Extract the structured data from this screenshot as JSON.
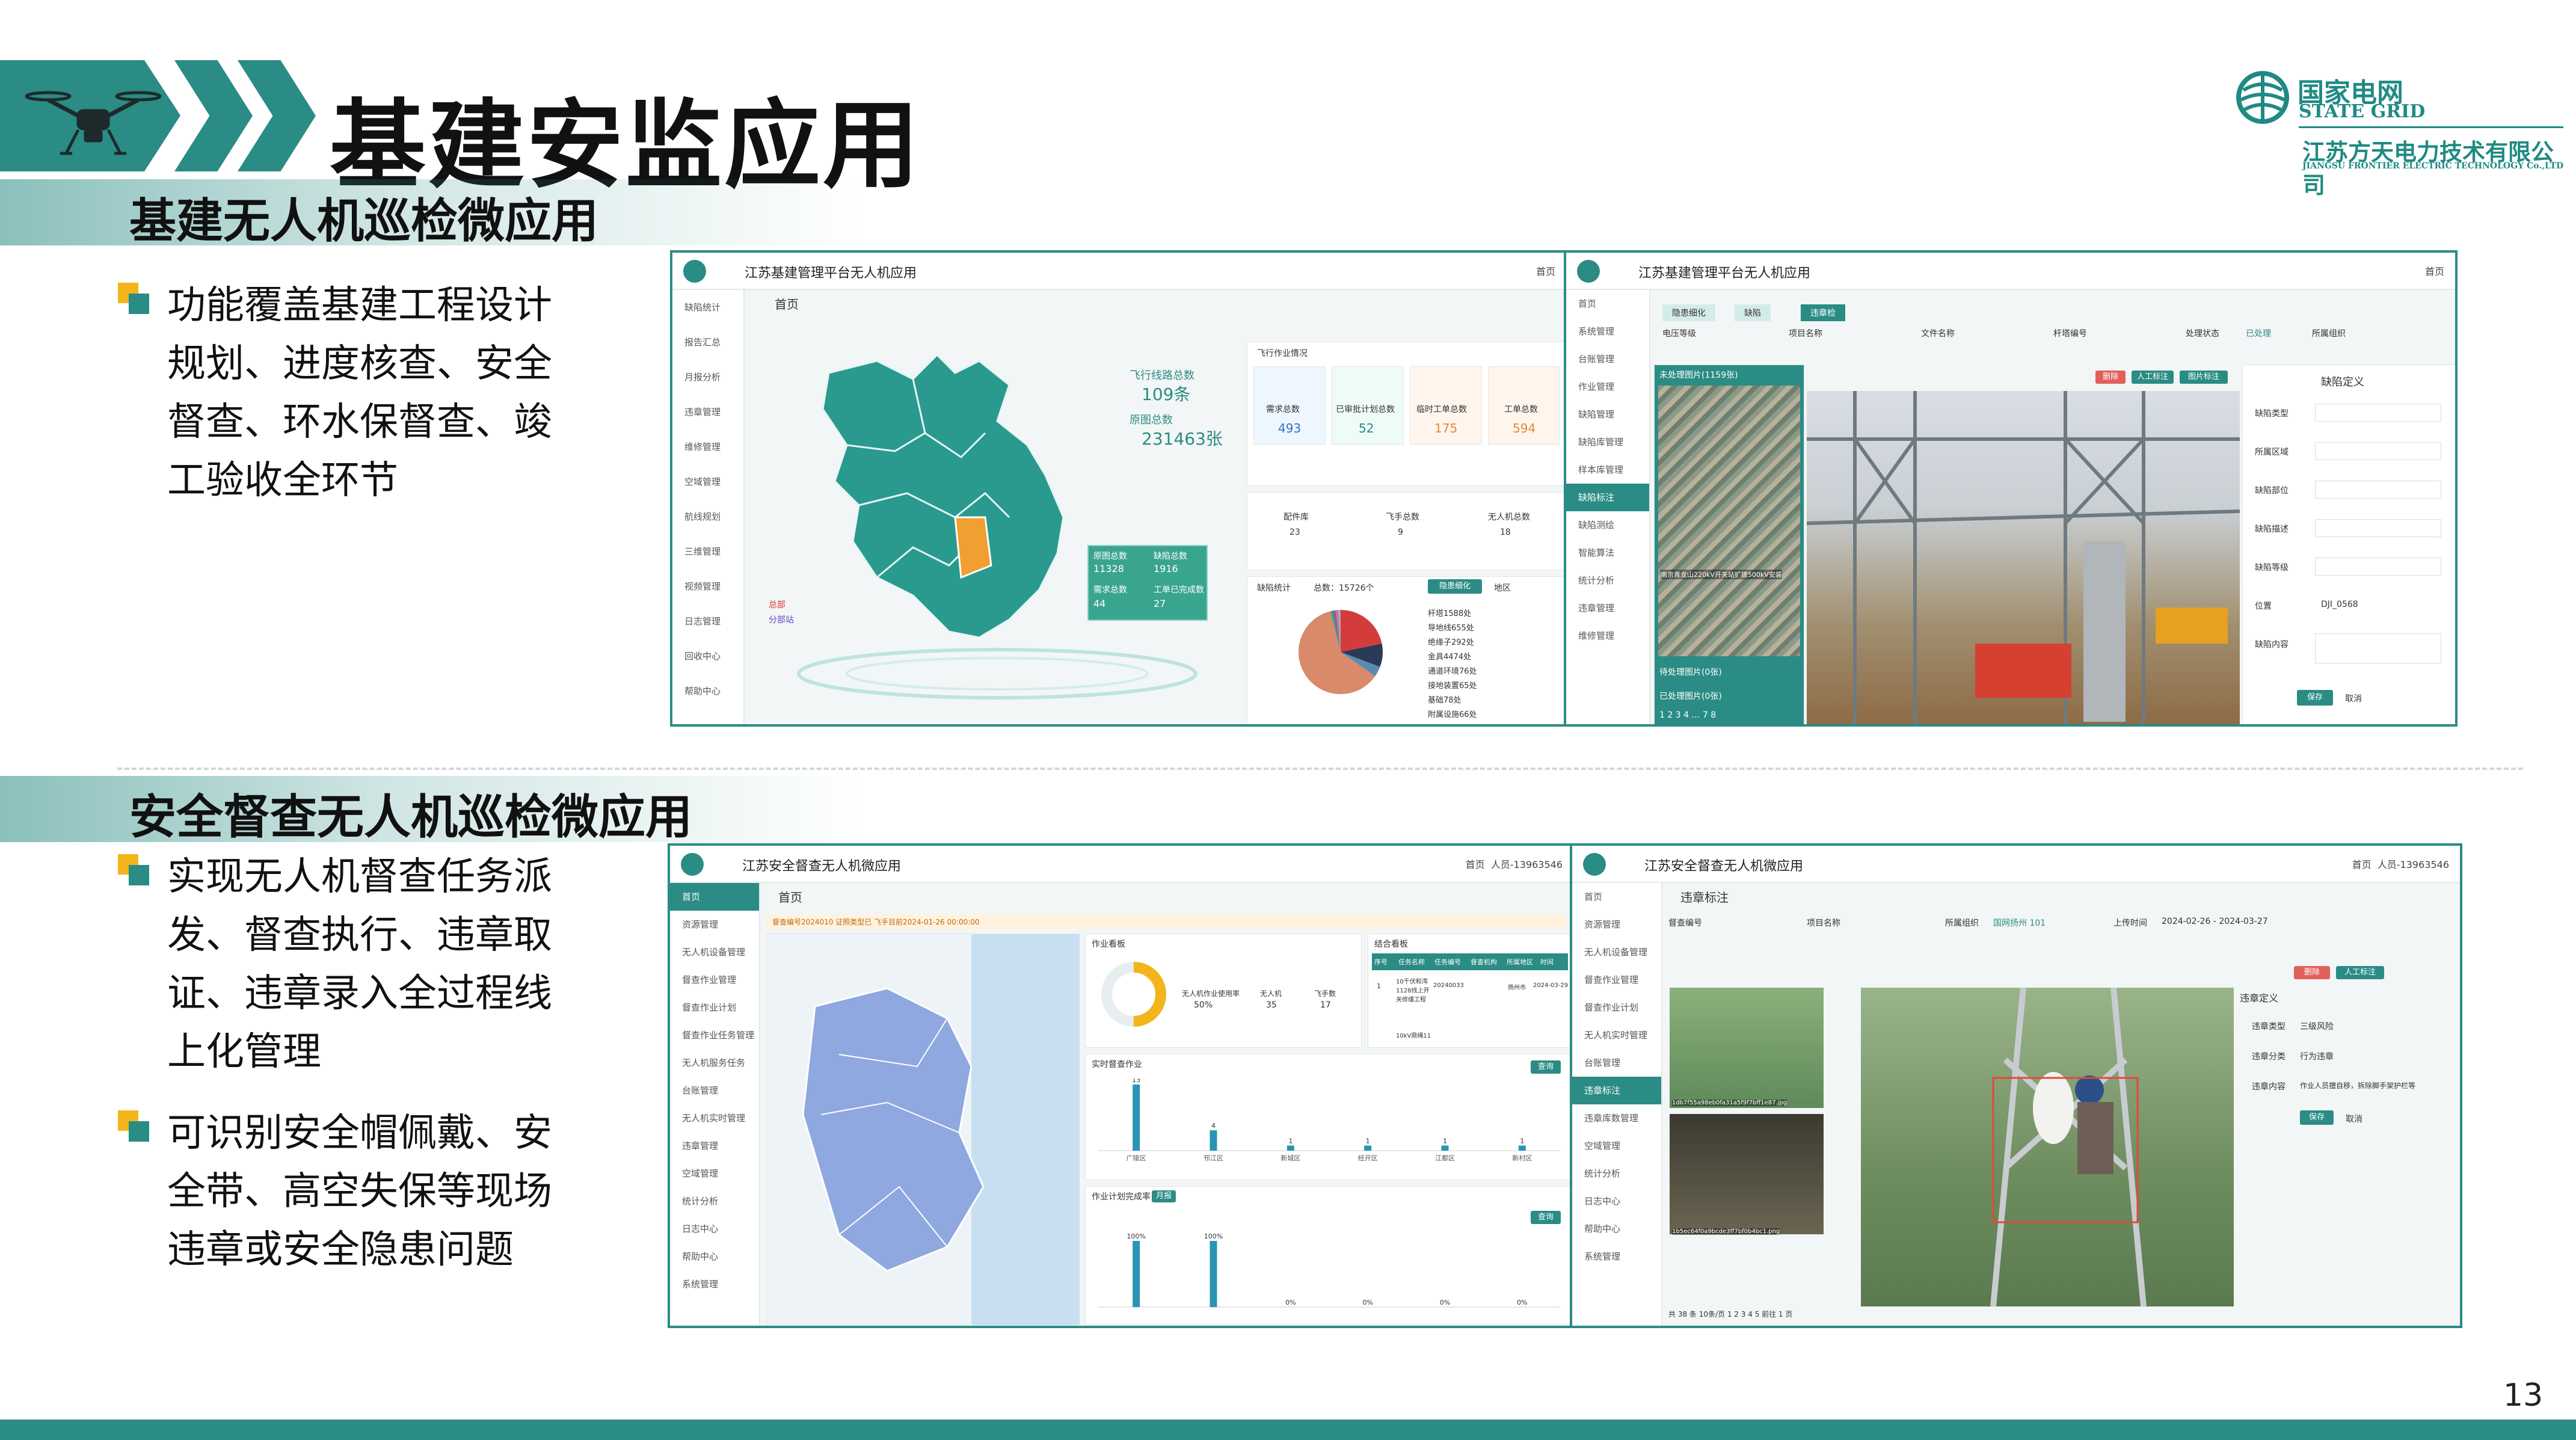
{
  "page": {
    "title": "基建安监应用",
    "number": "13"
  },
  "logo": {
    "name_cn": "国家电网",
    "name_en": "STATE GRID",
    "company_cn": "江苏方天电力技术有限公司",
    "company_en": "JIANGSU FRONTIER ELECTRIC TECHNOLOGY Co.,LTD"
  },
  "section1": {
    "title": "基建无人机巡检微应用",
    "bullet_lines": [
      "功能覆盖基建工程设计",
      "规划、进度核查、安全",
      "督查、环水保督查、竣",
      "工验收全环节"
    ]
  },
  "section2": {
    "title": "安全督查无人机巡检微应用",
    "bullet1_lines": [
      "实现无人机督查任务派",
      "发、督查执行、违章取",
      "证、违章录入全过程线",
      "上化管理"
    ],
    "bullet2_lines": [
      "可识别安全帽佩戴、安",
      "全带、高空失保等现场",
      "违章或安全隐患问题"
    ]
  },
  "shot1": {
    "app_title": "江苏基建管理平台无人机应用",
    "top_right": "首页",
    "crumb": "首页",
    "sidebar": [
      "缺陷统计",
      "报告汇总",
      "月报分析",
      "违章管理",
      "维修管理",
      "空域管理",
      "航线规划",
      "三维管理",
      "视频管理",
      "日志管理",
      "回收中心",
      "帮助中心"
    ],
    "stats_map": [
      {
        "label": "飞行线路总数",
        "value": "109条"
      },
      {
        "label": "原图总数",
        "value": "231463张"
      }
    ],
    "flight_title": "飞行作业情况",
    "flight_cards": [
      {
        "label": "需求总数",
        "value": "493"
      },
      {
        "label": "已审批计划总数",
        "value": "52"
      },
      {
        "label": "临时工单总数",
        "value": "175"
      },
      {
        "label": "工单总数",
        "value": "594"
      }
    ],
    "fleet": [
      {
        "label": "配件库",
        "value": "23"
      },
      {
        "label": "飞手总数",
        "value": "9"
      },
      {
        "label": "无人机总数",
        "value": "18"
      }
    ],
    "popup": [
      {
        "label": "原图总数",
        "value": "11328"
      },
      {
        "label": "缺陷总数",
        "value": "1916"
      },
      {
        "label": "需求总数",
        "value": "44"
      },
      {
        "label": "工单已完成数",
        "value": "27"
      }
    ],
    "map_legend": [
      "总部",
      "分部站"
    ],
    "defect_title": "缺陷统计",
    "defect_total": "总数：15726个",
    "defect_tabs": [
      "隐患细化",
      "地区"
    ],
    "defect_legend": [
      "杆塔1588处",
      "导地线655处",
      "绝缘子292处",
      "金具4474处",
      "通道环境76处",
      "接地装置65处",
      "基础78处",
      "附属设施66处"
    ],
    "pie": [
      {
        "value": 1588,
        "color": "#d43c3c"
      },
      {
        "value": 655,
        "color": "#2b3a55"
      },
      {
        "value": 292,
        "color": "#5a8bb0"
      },
      {
        "value": 4474,
        "color": "#d98a6a"
      },
      {
        "value": 76,
        "color": "#3aa17e"
      },
      {
        "value": 65,
        "color": "#8b5a96"
      },
      {
        "value": 78,
        "color": "#c96fa0"
      },
      {
        "value": 66,
        "color": "#9fb0b5"
      }
    ]
  },
  "shot2": {
    "app_title": "江苏基建管理平台无人机应用",
    "top_right": "首页",
    "tabs": [
      "隐患细化",
      "缺陷",
      "违章检"
    ],
    "sidebar": [
      "首页",
      "系统管理",
      "台账管理",
      "作业管理",
      "缺陷管理",
      "缺陷库管理",
      "样本库管理",
      "缺陷标注",
      "缺陷测绘",
      "智能算法",
      "统计分析",
      "违章管理",
      "维修管理"
    ],
    "filters": [
      "电压等级",
      "项目名称",
      "文件名称",
      "杆塔编号",
      "处理状态",
      "所属组织"
    ],
    "filter_status": "已处理",
    "list_header": "未处理图片(1159张)",
    "list_footer1": "待处理图片(0张)",
    "list_footer2": "已处理图片(0张)",
    "thumb_caption": "南京青龙山220kV开关站扩建500kV安装",
    "detail_title": "缺陷定义",
    "detail_fields": [
      "缺陷类型",
      "所属区域",
      "缺陷部位",
      "缺陷描述",
      "缺陷等级",
      "位置",
      "缺陷内容"
    ],
    "detail_position": "DJI_0568",
    "buttons": [
      "保存",
      "取消"
    ],
    "toolbar": [
      "删除",
      "人工标注",
      "图片标注"
    ],
    "pager": "1 2 3 4 … 7 8"
  },
  "shot3": {
    "app_title": "江苏安全督查无人机微应用",
    "top_right": "首页",
    "user": "人员-13963546",
    "crumb": "首页",
    "sidebar": [
      "首页",
      "资源管理",
      "无人机设备管理",
      "督查作业管理",
      "督查作业计划",
      "督查作业任务管理",
      "无人机服务任务",
      "台账管理",
      "无人机实时管理",
      "违章管理",
      "空域管理",
      "统计分析",
      "日志中心",
      "帮助中心",
      "系统管理"
    ],
    "alert": "督查编号2024010 证照类型已    飞手目前2024-01-26 00:00:00",
    "job_title": "作业看板",
    "job_stats": [
      {
        "label": "无人机作业使用率",
        "value": "50%"
      },
      {
        "label": "无人机",
        "value": "35"
      },
      {
        "label": "飞手数",
        "value": "17"
      }
    ],
    "ring_value": 50,
    "table_title": "结合看板",
    "table_headers": [
      "序号",
      "任务名称",
      "任务编号",
      "督查机构",
      "所属地区",
      "时间"
    ],
    "table_row": [
      "1",
      "10千伏和湾1128线上开关修缮工程",
      "20240033",
      "",
      "扬州市",
      "2024-03-29"
    ],
    "table_row2": "10kV鼎绳11",
    "bar1_title": "实时督查作业",
    "bar1": {
      "categories": [
        "广陵区",
        "邗江区",
        "新城区",
        "经开区",
        "江都区",
        "新村区"
      ],
      "values": [
        13,
        4,
        1,
        1,
        1,
        1
      ]
    },
    "bar2_title": "作业计划完成率",
    "bar2_tab": "月报",
    "bar2_labels": [
      "100%",
      "100%",
      "0%",
      "0%",
      "0%",
      "0%"
    ],
    "bar2_values": [
      100,
      100,
      0,
      0,
      0,
      0
    ],
    "query_btn": "查询"
  },
  "shot4": {
    "app_title": "江苏安全督查无人机微应用",
    "top_right": "首页",
    "user": "人员-13963546",
    "crumb": "违章标注",
    "sidebar": [
      "首页",
      "资源管理",
      "无人机设备管理",
      "督查作业管理",
      "督查作业计划",
      "无人机实时管理",
      "台账管理",
      "违章标注",
      "违章库数管理",
      "空域管理",
      "统计分析",
      "日志中心",
      "帮助中心",
      "系统管理"
    ],
    "filters": [
      "督查编号",
      "项目名称",
      "所属组织",
      "上传时间"
    ],
    "filter_org": "国网扬州 101",
    "date_range": "2024-02-26 - 2024-03-27",
    "detail_title": "违章定义",
    "detail_fields": [
      {
        "label": "违章类型",
        "value": "三级风险"
      },
      {
        "label": "违章分类",
        "value": "行为违章"
      },
      {
        "label": "违章内容",
        "value": "作业人员擅自移，拆除脚手架护栏等"
      }
    ],
    "buttons": [
      "保存",
      "取消"
    ],
    "toolbar": [
      "删除",
      "人工标注"
    ],
    "pager": "共 38 条    10条/页    1 2 3 4 5    前往 1 页",
    "thumb_captions": [
      "1db7f55a98eb0fa31a5f9f7bff1e87.jpg",
      "1b5ec64f0a9bcde3ff7bf0b4bc1.png"
    ]
  }
}
